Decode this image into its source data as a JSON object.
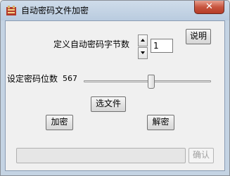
{
  "window": {
    "title": "自动密码文件加密",
    "close_glyph": "✕"
  },
  "spinner": {
    "label": "定义自动密码字节数",
    "value": "1"
  },
  "help_button": "说明",
  "slider": {
    "label": "设定密码位数",
    "value_text": "567",
    "level_percent": 53
  },
  "select_file_button": "选文件",
  "encrypt_button": "加密",
  "decrypt_button": "解密",
  "progress": {
    "fill_percent": 0
  },
  "confirm_button": "确认"
}
